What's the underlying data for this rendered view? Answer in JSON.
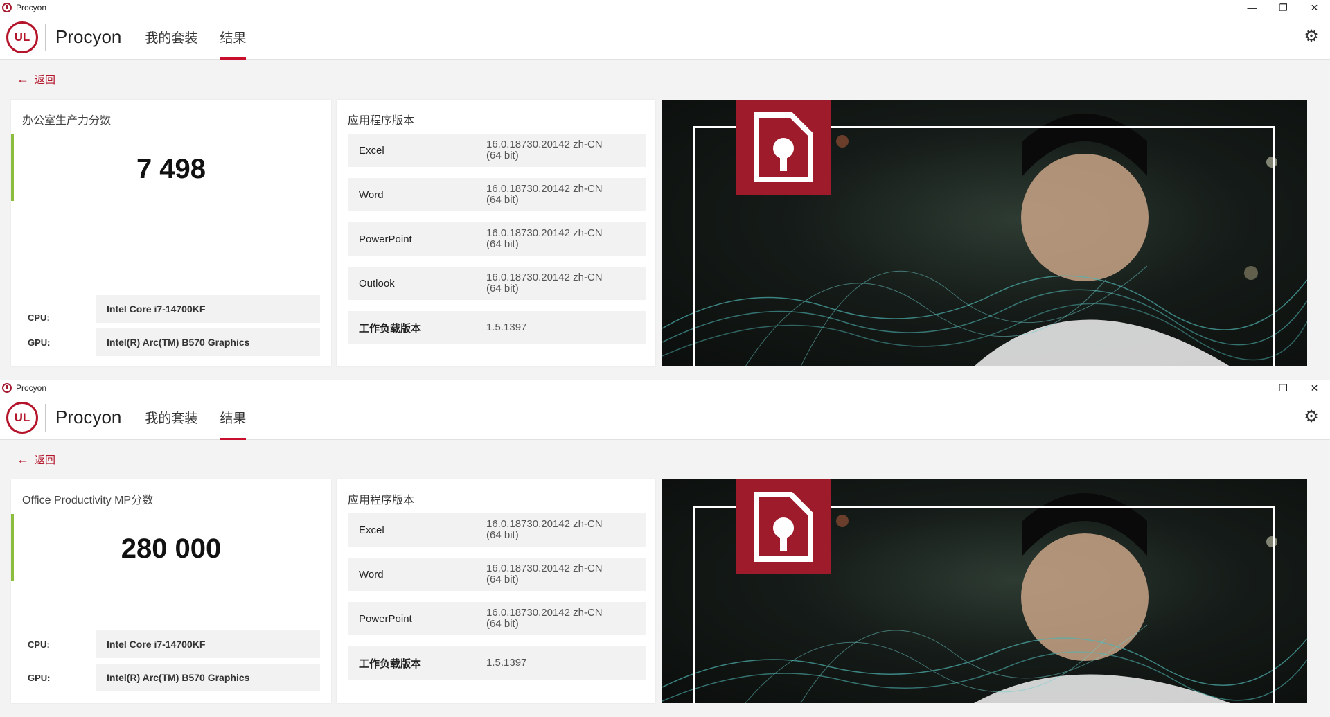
{
  "windows": [
    {
      "title": "Procyon",
      "brand": "Procyon",
      "logo_text": "UL",
      "nav": [
        "我的套装",
        "结果"
      ],
      "back_label": "返回",
      "score_heading": "办公室生产力分数",
      "score": "7 498",
      "cpu_label": "CPU:",
      "cpu": "Intel Core i7-14700KF",
      "gpu_label": "GPU:",
      "gpu": "Intel(R) Arc(TM) B570 Graphics",
      "apps_heading": "应用程序版本",
      "apps": [
        {
          "name": "Excel",
          "version_line1": "16.0.18730.20142 zh-CN",
          "version_line2": "(64 bit)"
        },
        {
          "name": "Word",
          "version_line1": "16.0.18730.20142 zh-CN",
          "version_line2": "(64 bit)"
        },
        {
          "name": "PowerPoint",
          "version_line1": "16.0.18730.20142 zh-CN",
          "version_line2": "(64 bit)"
        },
        {
          "name": "Outlook",
          "version_line1": "16.0.18730.20142 zh-CN",
          "version_line2": "(64 bit)"
        },
        {
          "name": "工作负载版本",
          "version_line1": "1.5.1397",
          "version_line2": ""
        }
      ]
    },
    {
      "title": "Procyon",
      "brand": "Procyon",
      "logo_text": "UL",
      "nav": [
        "我的套装",
        "结果"
      ],
      "back_label": "返回",
      "score_heading": "Office Productivity MP分数",
      "score": "280 000",
      "cpu_label": "CPU:",
      "cpu": "Intel Core i7-14700KF",
      "gpu_label": "GPU:",
      "gpu": "Intel(R) Arc(TM) B570 Graphics",
      "apps_heading": "应用程序版本",
      "apps": [
        {
          "name": "Excel",
          "version_line1": "16.0.18730.20142 zh-CN",
          "version_line2": "(64 bit)"
        },
        {
          "name": "Word",
          "version_line1": "16.0.18730.20142 zh-CN",
          "version_line2": "(64 bit)"
        },
        {
          "name": "PowerPoint",
          "version_line1": "16.0.18730.20142 zh-CN",
          "version_line2": "(64 bit)"
        },
        {
          "name": "工作负载版本",
          "version_line1": "1.5.1397",
          "version_line2": ""
        }
      ]
    }
  ],
  "icons": {
    "minimize": "—",
    "restore": "❐",
    "close": "✕",
    "gear": "⚙",
    "back_arrow": "←"
  },
  "colors": {
    "brand_red": "#b4152b",
    "score_accent": "#8cbd3f"
  }
}
